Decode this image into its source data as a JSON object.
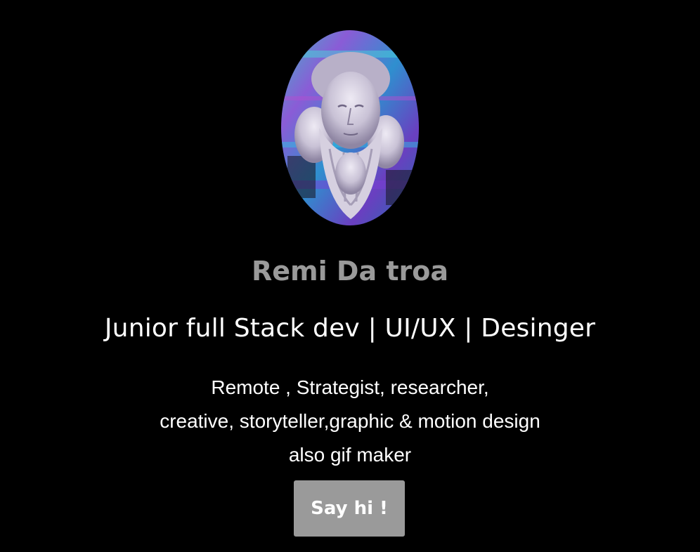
{
  "profile": {
    "avatar_icon": "bust-avatar-image",
    "name": "Remi Da troa",
    "tagline": "Junior full Stack dev | UI/UX | Desinger",
    "bio_lines": [
      "Remote , Strategist, researcher,",
      "creative, storyteller,graphic & motion design",
      "also gif maker"
    ]
  },
  "cta": {
    "label": "Say hi !"
  },
  "colors": {
    "background": "#000000",
    "name": "#9a9a9a",
    "text": "#ffffff",
    "button": "#9a9a9a"
  }
}
